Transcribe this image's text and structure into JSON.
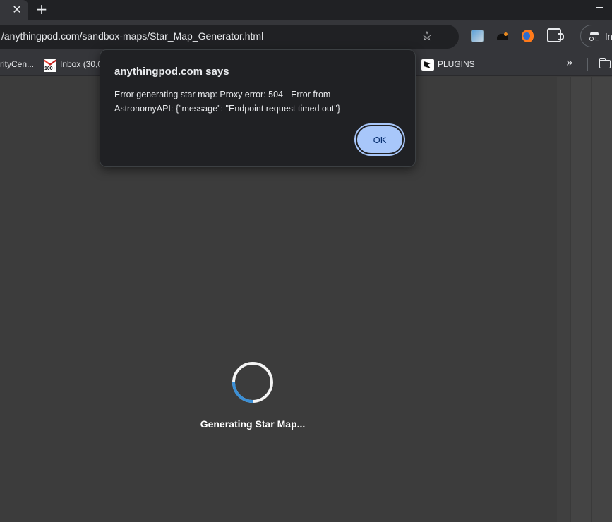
{
  "browser": {
    "tab_close": "✕",
    "new_tab": "+",
    "url": "/anythingpod.com/sandbox-maps/Star_Map_Generator.html",
    "profile_label": "In",
    "bookmarks": [
      {
        "label": "rityCen...",
        "icon": "none"
      },
      {
        "label": "Inbox (30,0",
        "icon": "gmail-icon",
        "badge": "100+"
      },
      {
        "label": "PLUGINS",
        "icon": "plugins-icon"
      }
    ],
    "overflow": "»"
  },
  "page": {
    "loading_text": "Generating Star Map...",
    "spinner_accent": "#3a8fd6",
    "spinner_track": "#f5f5f5"
  },
  "dialog": {
    "title": "anythingpod.com says",
    "message_line1": "Error generating star map: Proxy error: 504  - Error from",
    "message_line2": "AstronomyAPI: {\"message\": \"Endpoint request timed out\"}",
    "ok_label": "OK"
  }
}
